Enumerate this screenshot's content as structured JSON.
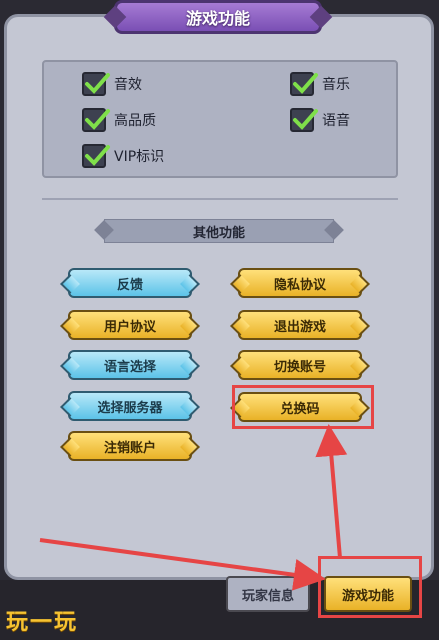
{
  "dialog": {
    "title": "游戏功能"
  },
  "settings": {
    "options": [
      {
        "label": "音效",
        "checked": true
      },
      {
        "label": "音乐",
        "checked": true
      },
      {
        "label": "高品质",
        "checked": true
      },
      {
        "label": "语音",
        "checked": true
      },
      {
        "label": "VIP标识",
        "checked": true
      }
    ]
  },
  "other": {
    "title": "其他功能",
    "buttons": [
      {
        "label": "反馈",
        "color": "blue"
      },
      {
        "label": "隐私协议",
        "color": "gold"
      },
      {
        "label": "用户协议",
        "color": "gold"
      },
      {
        "label": "退出游戏",
        "color": "gold"
      },
      {
        "label": "语言选择",
        "color": "blue"
      },
      {
        "label": "切换账号",
        "color": "gold"
      },
      {
        "label": "选择服务器",
        "color": "blue"
      },
      {
        "label": "兑换码",
        "color": "gold"
      },
      {
        "label": "注销账户",
        "color": "gold"
      }
    ]
  },
  "tabs": {
    "player_info": "玩家信息",
    "game_functions": "游戏功能"
  },
  "watermark": "玩一玩",
  "colors": {
    "highlight": "#e64545",
    "check": "#7fe04a",
    "button_blue": "#5cc3e8",
    "button_gold": "#e9b227",
    "panel": "#c4c7d3"
  }
}
